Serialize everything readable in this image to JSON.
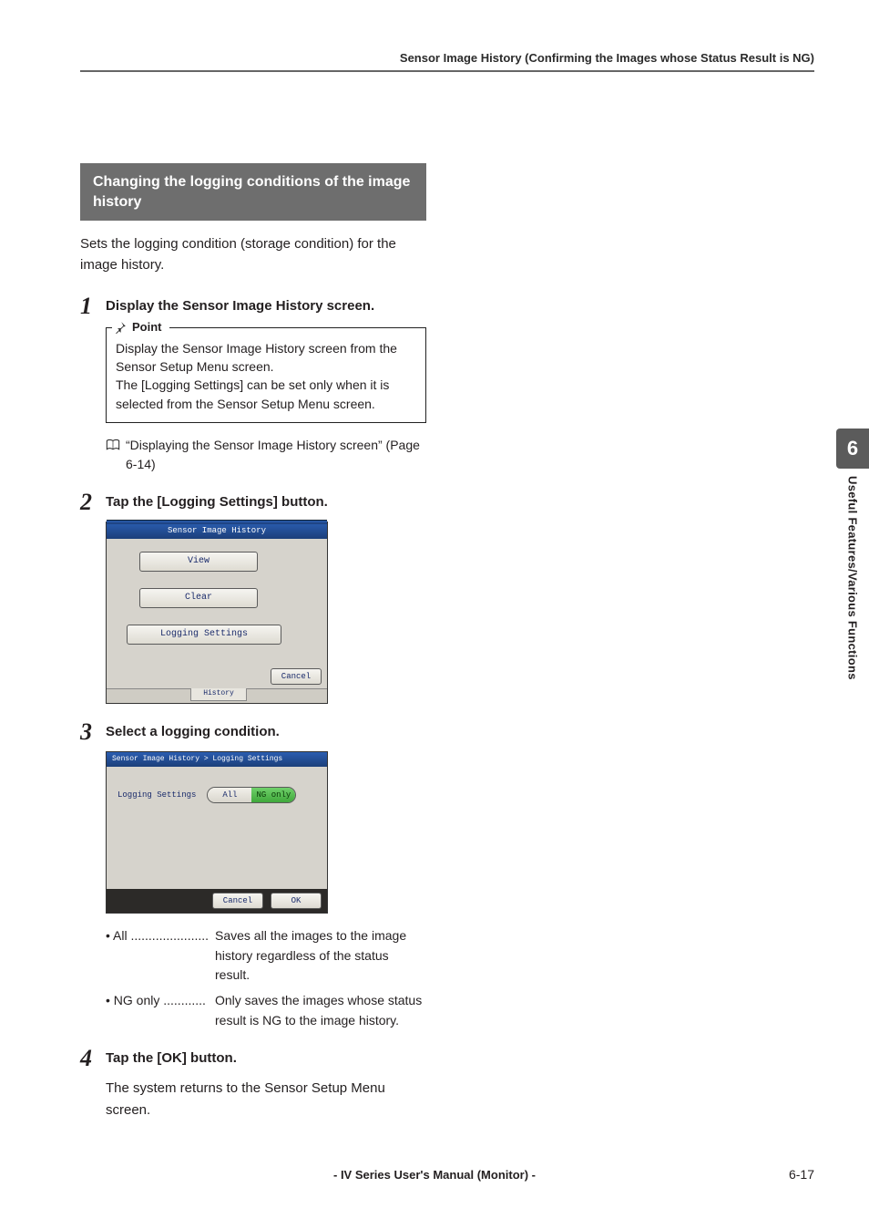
{
  "header": {
    "running": "Sensor Image History (Confirming the Images whose Status Result is NG)"
  },
  "section": {
    "title": "Changing the logging conditions of the image history",
    "intro": "Sets the logging condition (storage condition) for the image history."
  },
  "steps": {
    "s1": {
      "num": "1",
      "title": "Display the Sensor Image History screen.",
      "point_label": "Point",
      "point_body": "Display the Sensor Image History screen from the Sensor Setup Menu screen.\nThe [Logging Settings] can be set only when it is selected from the Sensor Setup Menu screen.",
      "ref": "“Displaying the Sensor Image History screen” (Page 6-14)"
    },
    "s2": {
      "num": "2",
      "title": "Tap the [Logging Settings] button.",
      "ui": {
        "title": "Sensor Image History",
        "btn_view": "View",
        "btn_clear": "Clear",
        "btn_logging": "Logging Settings",
        "btn_cancel": "Cancel",
        "tab": "History"
      }
    },
    "s3": {
      "num": "3",
      "title": "Select a logging condition.",
      "ui": {
        "breadcrumb": "Sensor Image History > Logging Settings",
        "label": "Logging Settings",
        "opt_all": "All",
        "opt_ng": "NG only",
        "btn_cancel": "Cancel",
        "btn_ok": "OK"
      },
      "defs": {
        "all_term": "• All ......................",
        "all_body": "Saves all the images to the image history regardless of the status result.",
        "ng_term": "• NG only ............",
        "ng_body": "Only saves the images whose status result is NG to the image history."
      }
    },
    "s4": {
      "num": "4",
      "title": "Tap the [OK] button.",
      "body": "The system returns to the Sensor Setup Menu screen."
    }
  },
  "side": {
    "chapter": "6",
    "label": "Useful Features/Various Functions"
  },
  "footer": {
    "center": "- IV Series User's Manual (Monitor) -",
    "page": "6-17"
  }
}
